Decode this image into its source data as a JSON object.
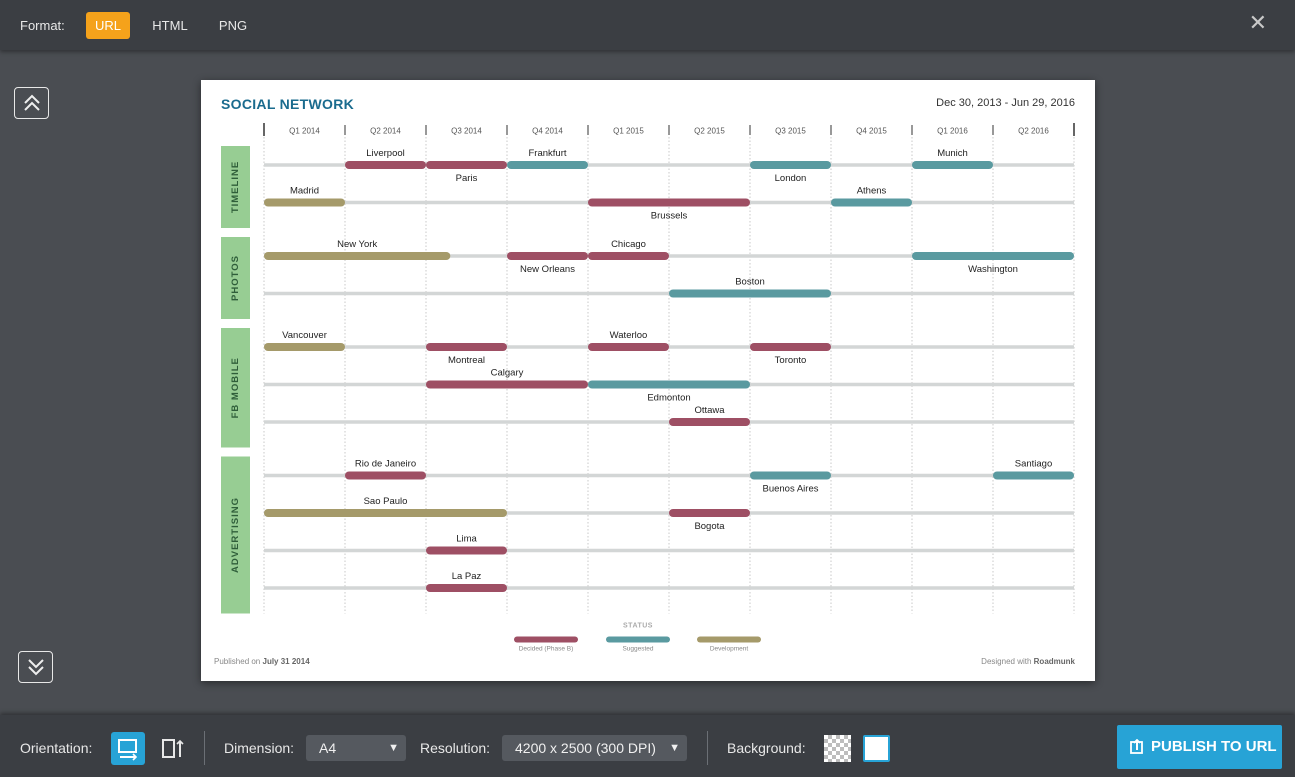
{
  "topbar": {
    "format_label": "Format:",
    "formats": [
      "URL",
      "HTML",
      "PNG"
    ],
    "active_format": "URL",
    "close_icon": "close-icon"
  },
  "roadmap": {
    "title": "SOCIAL NETWORK",
    "date_range": "Dec 30, 2013 - Jun 29, 2016",
    "quarters": [
      "Q1 2014",
      "Q2 2014",
      "Q3 2014",
      "Q4 2014",
      "Q1 2015",
      "Q2 2015",
      "Q3 2015",
      "Q4 2015",
      "Q1 2016",
      "Q2 2016"
    ],
    "swimlanes": [
      {
        "name": "TIMELINE",
        "rows": 2
      },
      {
        "name": "PHOTOS",
        "rows": 2
      },
      {
        "name": "FB MOBILE",
        "rows": 3
      },
      {
        "name": "ADVERTISING",
        "rows": 4
      }
    ],
    "items": [
      {
        "label": "Liverpool",
        "lane": 0,
        "row": 0,
        "start": 1.0,
        "end": 2.0,
        "status": "decided",
        "label_pos": "above"
      },
      {
        "label": "Paris",
        "lane": 0,
        "row": 0,
        "start": 2.0,
        "end": 3.0,
        "status": "decided",
        "label_pos": "below"
      },
      {
        "label": "Frankfurt",
        "lane": 0,
        "row": 0,
        "start": 3.0,
        "end": 4.0,
        "status": "suggested",
        "label_pos": "above"
      },
      {
        "label": "London",
        "lane": 0,
        "row": 0,
        "start": 6.0,
        "end": 7.0,
        "status": "suggested",
        "label_pos": "below"
      },
      {
        "label": "Munich",
        "lane": 0,
        "row": 0,
        "start": 8.0,
        "end": 9.0,
        "status": "suggested",
        "label_pos": "above"
      },
      {
        "label": "Madrid",
        "lane": 0,
        "row": 1,
        "start": 0.0,
        "end": 1.0,
        "status": "development",
        "label_pos": "above"
      },
      {
        "label": "Brussels",
        "lane": 0,
        "row": 1,
        "start": 4.0,
        "end": 6.0,
        "status": "decided",
        "label_pos": "below"
      },
      {
        "label": "Athens",
        "lane": 0,
        "row": 1,
        "start": 7.0,
        "end": 8.0,
        "status": "suggested",
        "label_pos": "above"
      },
      {
        "label": "New York",
        "lane": 1,
        "row": 0,
        "start": 0.0,
        "end": 2.3,
        "status": "development",
        "label_pos": "above"
      },
      {
        "label": "New Orleans",
        "lane": 1,
        "row": 0,
        "start": 3.0,
        "end": 4.0,
        "status": "decided",
        "label_pos": "below"
      },
      {
        "label": "Chicago",
        "lane": 1,
        "row": 0,
        "start": 4.0,
        "end": 5.0,
        "status": "decided",
        "label_pos": "above"
      },
      {
        "label": "Washington",
        "lane": 1,
        "row": 0,
        "start": 8.0,
        "end": 10.0,
        "status": "suggested",
        "label_pos": "below"
      },
      {
        "label": "Boston",
        "lane": 1,
        "row": 1,
        "start": 5.0,
        "end": 7.0,
        "status": "suggested",
        "label_pos": "above"
      },
      {
        "label": "Vancouver",
        "lane": 2,
        "row": 0,
        "start": 0.0,
        "end": 1.0,
        "status": "development",
        "label_pos": "above"
      },
      {
        "label": "Montreal",
        "lane": 2,
        "row": 0,
        "start": 2.0,
        "end": 3.0,
        "status": "decided",
        "label_pos": "below"
      },
      {
        "label": "Waterloo",
        "lane": 2,
        "row": 0,
        "start": 4.0,
        "end": 5.0,
        "status": "decided",
        "label_pos": "above"
      },
      {
        "label": "Toronto",
        "lane": 2,
        "row": 0,
        "start": 6.0,
        "end": 7.0,
        "status": "decided",
        "label_pos": "below"
      },
      {
        "label": "Calgary",
        "lane": 2,
        "row": 1,
        "start": 2.0,
        "end": 4.0,
        "status": "decided",
        "label_pos": "above"
      },
      {
        "label": "Edmonton",
        "lane": 2,
        "row": 1,
        "start": 4.0,
        "end": 6.0,
        "status": "suggested",
        "label_pos": "below"
      },
      {
        "label": "Ottawa",
        "lane": 2,
        "row": 2,
        "start": 5.0,
        "end": 6.0,
        "status": "decided",
        "label_pos": "above"
      },
      {
        "label": "Rio de Janeiro",
        "lane": 3,
        "row": 0,
        "start": 1.0,
        "end": 2.0,
        "status": "decided",
        "label_pos": "above"
      },
      {
        "label": "Buenos Aires",
        "lane": 3,
        "row": 0,
        "start": 6.0,
        "end": 7.0,
        "status": "suggested",
        "label_pos": "below"
      },
      {
        "label": "Santiago",
        "lane": 3,
        "row": 0,
        "start": 9.0,
        "end": 10.0,
        "status": "suggested",
        "label_pos": "above"
      },
      {
        "label": "Sao Paulo",
        "lane": 3,
        "row": 1,
        "start": 0.0,
        "end": 3.0,
        "status": "development",
        "label_pos": "above"
      },
      {
        "label": "Bogota",
        "lane": 3,
        "row": 1,
        "start": 5.0,
        "end": 6.0,
        "status": "decided",
        "label_pos": "below"
      },
      {
        "label": "Lima",
        "lane": 3,
        "row": 2,
        "start": 2.0,
        "end": 3.0,
        "status": "decided",
        "label_pos": "above"
      },
      {
        "label": "La Paz",
        "lane": 3,
        "row": 3,
        "start": 2.0,
        "end": 3.0,
        "status": "decided",
        "label_pos": "above"
      }
    ],
    "legend": {
      "title": "STATUS",
      "entries": [
        {
          "key": "decided",
          "label": "Decided (Phase B)",
          "color": "#9e4f64"
        },
        {
          "key": "suggested",
          "label": "Suggested",
          "color": "#5a9aa0"
        },
        {
          "key": "development",
          "label": "Development",
          "color": "#a59a6a"
        }
      ]
    },
    "lane_color": "#97cd93",
    "published_prefix": "Published on",
    "published_date": "July 31 2014",
    "designed_prefix": "Designed with",
    "designed_brand": "Roadmunk"
  },
  "bottombar": {
    "orientation_label": "Orientation:",
    "orientation_active": "landscape",
    "dimension_label": "Dimension:",
    "dimension_value": "A4",
    "resolution_label": "Resolution:",
    "resolution_value": "4200 x 2500 (300 DPI)",
    "background_label": "Background:",
    "background_selected": "white",
    "publish_label": "PUBLISH TO URL"
  }
}
